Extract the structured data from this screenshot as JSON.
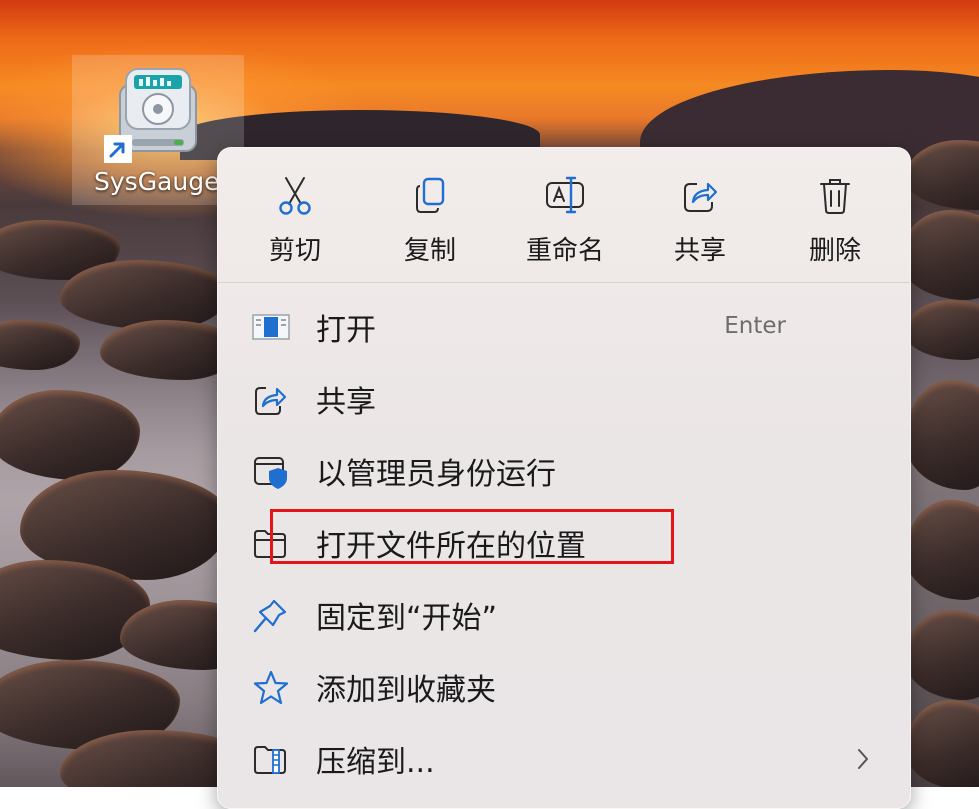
{
  "desktop": {
    "icon_label": "SysGauge",
    "icon_name": "sysgauge-app-icon"
  },
  "toolbar": {
    "cut": "剪切",
    "copy": "复制",
    "rename": "重命名",
    "share": "共享",
    "delete": "删除"
  },
  "menu": {
    "items": [
      {
        "label": "打开",
        "accelerator": "Enter",
        "icon": "open-app-icon"
      },
      {
        "label": "共享",
        "icon": "share-icon"
      },
      {
        "label": "以管理员身份运行",
        "icon": "shield-icon"
      },
      {
        "label": "打开文件所在的位置",
        "icon": "folder-icon"
      },
      {
        "label": "固定到“开始”",
        "icon": "pin-icon"
      },
      {
        "label": "添加到收藏夹",
        "icon": "star-icon"
      },
      {
        "label": "压缩到...",
        "icon": "zip-folder-icon",
        "submenu": true
      }
    ]
  },
  "colors": {
    "accent": "#1f6fd1",
    "highlight_box": "#e3151a",
    "menu_bg": "#ece7e7"
  }
}
